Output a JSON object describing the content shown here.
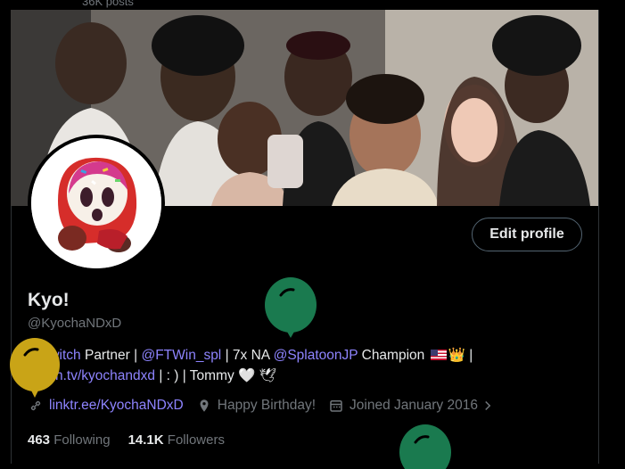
{
  "header": {
    "posts_count": "36K posts"
  },
  "profile": {
    "display_name": "Kyo!",
    "handle": "@KyochaNDxD",
    "edit_button": "Edit profile"
  },
  "bio": {
    "mention_twitch": "@Twitch",
    "text_partner": " Partner | ",
    "mention_ftwin": "@FTWin_spl",
    "text_na": " | 7x NA ",
    "mention_splatoon": "@SplatoonJP",
    "text_champion": " Champion ",
    "emoji_crown": "👑",
    "text_pipe": " |",
    "twitch_link": "twitch.tv/kyochandxd",
    "text_end": " | : ) | Tommy ",
    "emoji_heart": "🤍",
    "emoji_dove": "🕊"
  },
  "meta": {
    "website": "linktr.ee/KyochaNDxD",
    "location": "Happy Birthday!",
    "joined": "Joined January 2016"
  },
  "stats": {
    "following_count": "463",
    "following_label": "Following",
    "followers_count": "14.1K",
    "followers_label": "Followers"
  },
  "icons": [
    "link-icon",
    "location-pin-icon",
    "calendar-icon",
    "chevron-right-icon",
    "balloon-icon"
  ],
  "colors": {
    "background": "#000000",
    "text_primary": "#e7e9ea",
    "text_secondary": "#71767b",
    "link": "#8e84ff",
    "balloon_green": "#1a7a4f",
    "balloon_gold": "#c9a417"
  }
}
